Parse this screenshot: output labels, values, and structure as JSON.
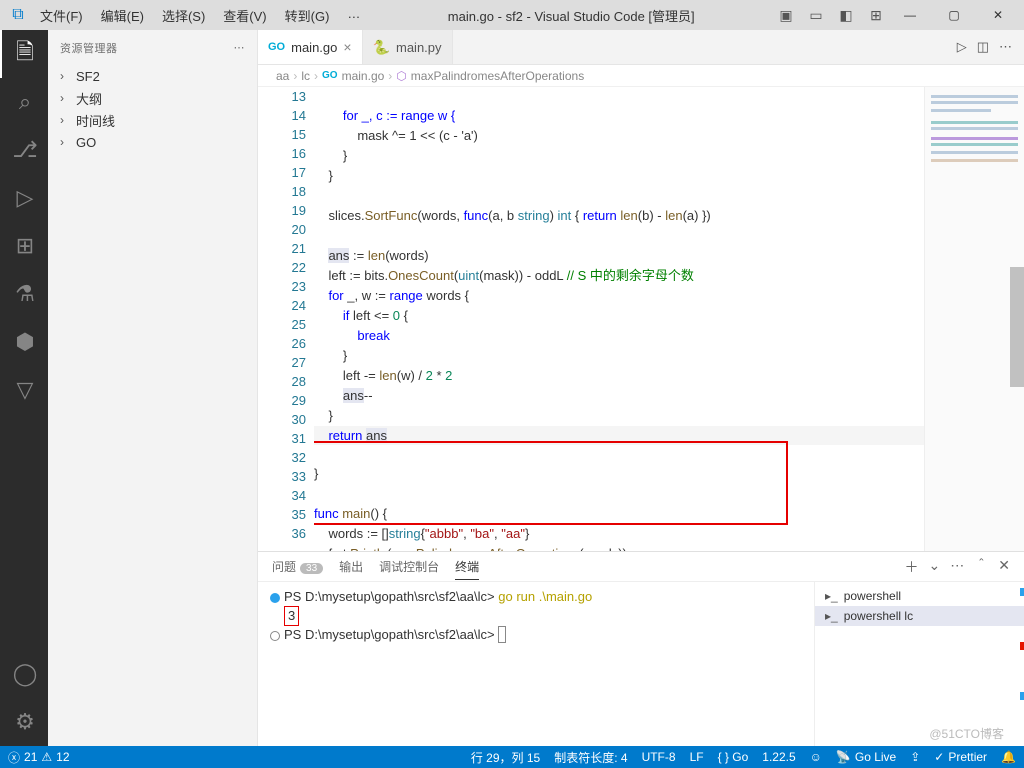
{
  "title": "main.go - sf2 - Visual Studio Code [管理员]",
  "menu": [
    "文件(F)",
    "编辑(E)",
    "选择(S)",
    "查看(V)",
    "转到(G)",
    "…"
  ],
  "sidebar": {
    "title": "资源管理器",
    "items": [
      "SF2",
      "大纲",
      "时间线",
      "GO"
    ]
  },
  "tabs": [
    {
      "label": "main.go",
      "icon": "go",
      "active": true
    },
    {
      "label": "main.py",
      "icon": "py",
      "active": false
    }
  ],
  "breadcrumb": [
    "aa",
    "lc",
    "main.go",
    "maxPalindromesAfterOperations"
  ],
  "lineNumbers": [
    "13",
    "14",
    "15",
    "16",
    "17",
    "18",
    "19",
    "20",
    "21",
    "22",
    "23",
    "24",
    "25",
    "26",
    "27",
    "28",
    "29",
    "30",
    "31",
    "32",
    "33",
    "34",
    "35",
    "36"
  ],
  "code": {
    "l13": "        for _, c := range w {",
    "l14": "            mask ^= 1 << (c - 'a')",
    "l15": "        }",
    "l16": "    }",
    "l18a": "    slices.",
    "l18b": "SortFunc",
    "l18c": "(words, ",
    "l18d": "func",
    "l18e": "(a, b ",
    "l18f": "string",
    "l18g": ") ",
    "l18h": "int",
    "l18i": " { ",
    "l18j": "return",
    "l18k": " ",
    "l18l": "len",
    "l18m": "(b) - ",
    "l18n": "len",
    "l18o": "(a) })",
    "l20a": "    ",
    "l20b": "ans",
    "l20c": " := ",
    "l20d": "len",
    "l20e": "(words)",
    "l21a": "    left := bits.",
    "l21b": "OnesCount",
    "l21c": "(",
    "l21d": "uint",
    "l21e": "(mask)) - oddL ",
    "l21f": "// S 中的剩余字母个数",
    "l22a": "    ",
    "l22b": "for",
    "l22c": " _, w := ",
    "l22d": "range",
    "l22e": " words {",
    "l23a": "        ",
    "l23b": "if",
    "l23c": " left <= ",
    "l23d": "0",
    "l23e": " {",
    "l24a": "            ",
    "l24b": "break",
    "l25": "        }",
    "l26a": "        left -= ",
    "l26b": "len",
    "l26c": "(w) / ",
    "l26d": "2",
    "l26e": " * ",
    "l26f": "2",
    "l27a": "        ",
    "l27b": "ans",
    "l27c": "--",
    "l28": "    }",
    "l29a": "    ",
    "l29b": "return",
    "l29c": " ",
    "l29d": "ans",
    "l30": "}",
    "l32a": "func",
    "l32b": " ",
    "l32c": "main",
    "l32d": "() {",
    "l33a": "    words := []",
    "l33b": "string",
    "l33c": "{",
    "l33d": "\"abbb\"",
    "l33e": ", ",
    "l33f": "\"ba\"",
    "l33g": ", ",
    "l33h": "\"aa\"",
    "l33i": "}",
    "l34a": "    fmt.",
    "l34b": "Println",
    "l34c": "(",
    "l34d": "maxPalindromesAfterOperations",
    "l34e": "(words))",
    "l35": "}"
  },
  "panel": {
    "tabs": {
      "problems": "问题",
      "pcount": "33",
      "output": "输出",
      "debug": "调试控制台",
      "terminal": "终端"
    },
    "term": {
      "prompt1": "PS D:\\mysetup\\gopath\\src\\sf2\\aa\\lc> ",
      "cmd1": "go run .\\main.go",
      "out": "3",
      "prompt2": "PS D:\\mysetup\\gopath\\src\\sf2\\aa\\lc> "
    },
    "shells": [
      "powershell",
      "powershell  lc"
    ]
  },
  "status": {
    "err": "21",
    "warn": "12",
    "line": "行 29，列 15",
    "tab": "制表符长度: 4",
    "enc": "UTF-8",
    "eol": "LF",
    "lang": "{ }  Go",
    "ver": "1.22.5",
    "golive": "Go Live",
    "prettier": "Prettier"
  },
  "watermark": "@51CTO博客"
}
